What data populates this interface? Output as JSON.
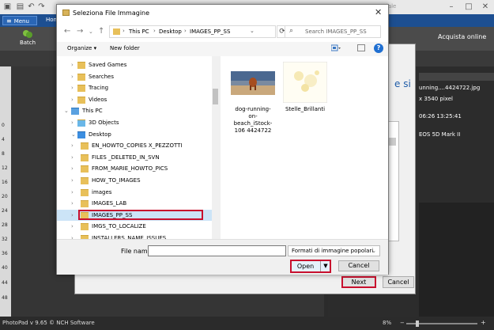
{
  "app": {
    "title_partial": "erciale",
    "menu_label": "Menu",
    "home_tab": "Hom",
    "batch_label": "Batch",
    "acquista_label": "Acquista online",
    "ruler_ticks": [
      "0",
      "4",
      "8",
      "12",
      "16",
      "20",
      "24",
      "28",
      "32",
      "36",
      "40",
      "44",
      "48"
    ],
    "status_version": "PhotoPad v 9.65 © NCH Software",
    "zoom": "8%"
  },
  "wizard": {
    "side_text": "e si",
    "info_lines": [
      "unning....4424722.jpg",
      "x 3540 pixel",
      "06:26 13:25:41",
      "EOS 5D Mark II"
    ],
    "next_label": "Next",
    "cancel_label": "Cancel"
  },
  "dialog": {
    "title": "Seleziona File Immagine",
    "breadcrumb": [
      "This PC",
      "Desktop",
      "IMAGES_PP_SS"
    ],
    "search_placeholder": "Search IMAGES_PP_SS",
    "organize_label": "Organize",
    "new_folder_label": "New folder",
    "tree": [
      {
        "label": "Saved Games",
        "level": 1
      },
      {
        "label": "Searches",
        "level": 1
      },
      {
        "label": "Tracing",
        "level": 1
      },
      {
        "label": "Videos",
        "level": 1
      },
      {
        "label": "This PC",
        "level": 0
      },
      {
        "label": "3D Objects",
        "level": 1
      },
      {
        "label": "Desktop",
        "level": 1
      },
      {
        "label": "EN_HOWTO_COPIES X_PEZZOTTI",
        "level": 2
      },
      {
        "label": "FILES _DELETED_IN_SVN",
        "level": 2
      },
      {
        "label": "FROM_MARIE_HOWTO_PICS",
        "level": 2
      },
      {
        "label": "HOW_TO_IMAGES",
        "level": 2
      },
      {
        "label": "images",
        "level": 2
      },
      {
        "label": "IMAGES_LAB",
        "level": 2
      },
      {
        "label": "IMAGES_PP_SS",
        "level": 2,
        "selected": true
      },
      {
        "label": "IMGS_TO_LOCALIZE",
        "level": 2
      },
      {
        "label": "INSTALLERS_NAME_ISSUES",
        "level": 2
      }
    ],
    "files": [
      {
        "caption": "dog-running-on-beach_iStock-106 4424722"
      },
      {
        "caption": "Stelle_Brillanti"
      }
    ],
    "filename_label": "File name:",
    "filename_value": "",
    "filetype_label": "Formati di immagine popolari",
    "open_label": "Open",
    "cancel_label": "Cancel",
    "highlight_color": "#c8102e"
  }
}
